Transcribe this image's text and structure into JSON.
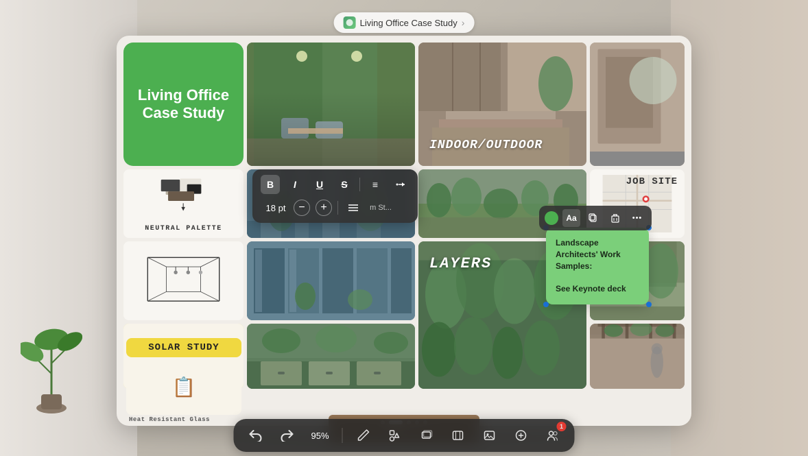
{
  "topBar": {
    "iconLabel": "🌿",
    "title": "Living Office Case Study",
    "chevron": "›"
  },
  "board": {
    "titleCard": {
      "line1": "Living Office",
      "line2": "Case Study"
    },
    "labels": {
      "indoorOutdoor": "INDOOR/OUTDOOR",
      "neutralPalette": "NEUTRAL PALETTE",
      "solarStudy": "SOLAR STUDY",
      "jobSite": "JOB SITE",
      "layers": "LAYERS",
      "heatResistantGlass": "Heat Resistant Glass"
    },
    "annotation": {
      "text": "Landscape Architects' Work Samples:\n\nSee Keynote deck"
    },
    "toolbar": {
      "bold": "B",
      "italic": "I",
      "underline": "U",
      "strikethrough": "S",
      "align": "≡",
      "more": "⋮",
      "fontSize": "18 pt",
      "listBtn": "≡",
      "previewLabel": "m St..."
    },
    "annotationToolbar": {
      "textBtn": "Aa",
      "copyBtn": "⧉",
      "deleteBtn": "🗑",
      "moreBtn": "•••"
    }
  },
  "bottomToolbar": {
    "undo": "↩",
    "redo": "↪",
    "zoom": "95%",
    "pencil": "✏",
    "shapes": "⬛",
    "layers": "⧉",
    "frame": "▭",
    "grid": "⊞",
    "circle": "○",
    "people": "👤",
    "badgeCount": "1"
  },
  "pageDots": [
    {
      "active": false
    },
    {
      "active": true
    },
    {
      "active": false
    },
    {
      "active": false
    },
    {
      "active": false
    }
  ]
}
